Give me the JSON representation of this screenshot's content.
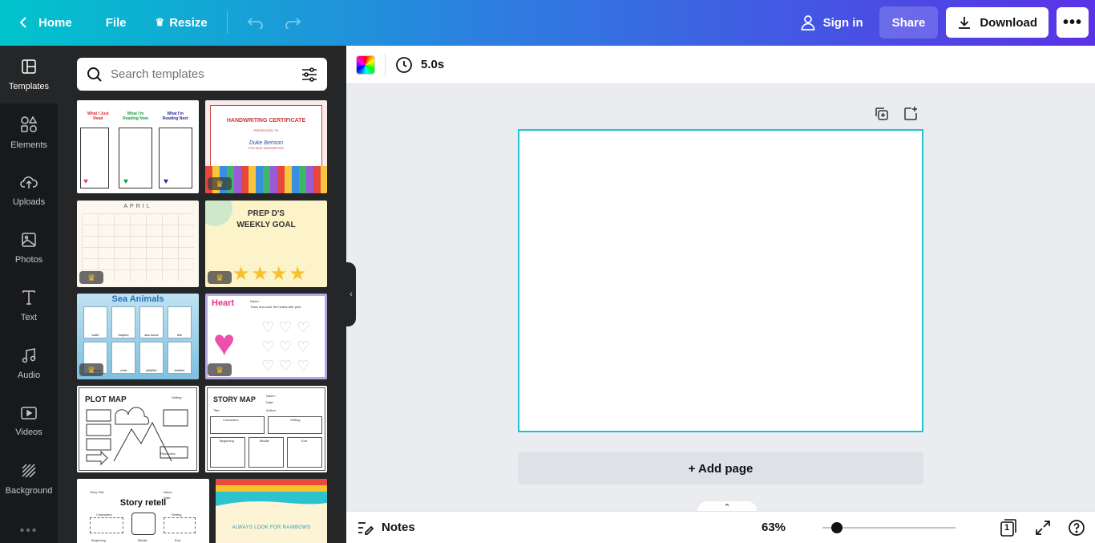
{
  "topbar": {
    "home": "Home",
    "file": "File",
    "resize": "Resize",
    "sign_in": "Sign in",
    "share": "Share",
    "download": "Download",
    "more": "•••"
  },
  "rail": {
    "items": [
      {
        "label": "Templates",
        "icon": "templates-icon"
      },
      {
        "label": "Elements",
        "icon": "elements-icon"
      },
      {
        "label": "Uploads",
        "icon": "uploads-icon"
      },
      {
        "label": "Photos",
        "icon": "photos-icon"
      },
      {
        "label": "Text",
        "icon": "text-icon"
      },
      {
        "label": "Audio",
        "icon": "audio-icon"
      },
      {
        "label": "Videos",
        "icon": "videos-icon"
      },
      {
        "label": "Background",
        "icon": "background-icon"
      }
    ],
    "more": "•••"
  },
  "panel": {
    "search_placeholder": "Search templates",
    "templates": [
      {
        "name": "reading-log",
        "texts": [
          "What I Just Read",
          "What I'm Reading Now",
          "What I'm Reading Next"
        ],
        "premium": false
      },
      {
        "name": "handwriting-certificate",
        "texts": [
          "HANDWRITING CERTIFICATE",
          "PRESENTED TO",
          "Duke Benson",
          "FOR NEAT HANDWRITING"
        ],
        "premium": true
      },
      {
        "name": "april-calendar",
        "texts": [
          "APRIL"
        ],
        "premium": true
      },
      {
        "name": "weekly-goal",
        "texts": [
          "PREP D'S",
          "WEEKLY GOAL"
        ],
        "premium": true
      },
      {
        "name": "sea-animals",
        "texts": [
          "Sea Animals",
          "turtle",
          "dolphin",
          "sea horse",
          "fish",
          "octopus",
          "crab",
          "jellyfish",
          "starfish"
        ],
        "premium": true
      },
      {
        "name": "heart-worksheet",
        "texts": [
          "Heart",
          "Name:",
          "Trace and color the hearts with pink."
        ],
        "premium": true
      },
      {
        "name": "plot-map",
        "texts": [
          "PLOT MAP",
          "Setting",
          "Resolution"
        ],
        "premium": false
      },
      {
        "name": "story-map",
        "texts": [
          "STORY MAP",
          "Name:",
          "Date:",
          "Title:",
          "Author:",
          "Characters",
          "Setting",
          "Beginning",
          "Middle",
          "End"
        ],
        "premium": false
      },
      {
        "name": "story-retell",
        "texts": [
          "Story Title",
          "Name",
          "Date",
          "Story retell",
          "Characters",
          "Setting",
          "Beginning",
          "Middle",
          "End"
        ],
        "premium": false
      },
      {
        "name": "rainbow",
        "texts": [
          "ALWAYS LOOK FOR RAINBOWS"
        ],
        "premium": false
      }
    ]
  },
  "editor": {
    "duration": "5.0s",
    "add_page": "+ Add page",
    "notes": "Notes",
    "zoom": "63%",
    "zoom_fraction": 0.11,
    "page_count": "1"
  },
  "colors": {
    "canvas_border": "#1fc3cf",
    "rail_bg": "#18191b",
    "panel_bg": "#252627",
    "crown": "#f7c12e"
  }
}
